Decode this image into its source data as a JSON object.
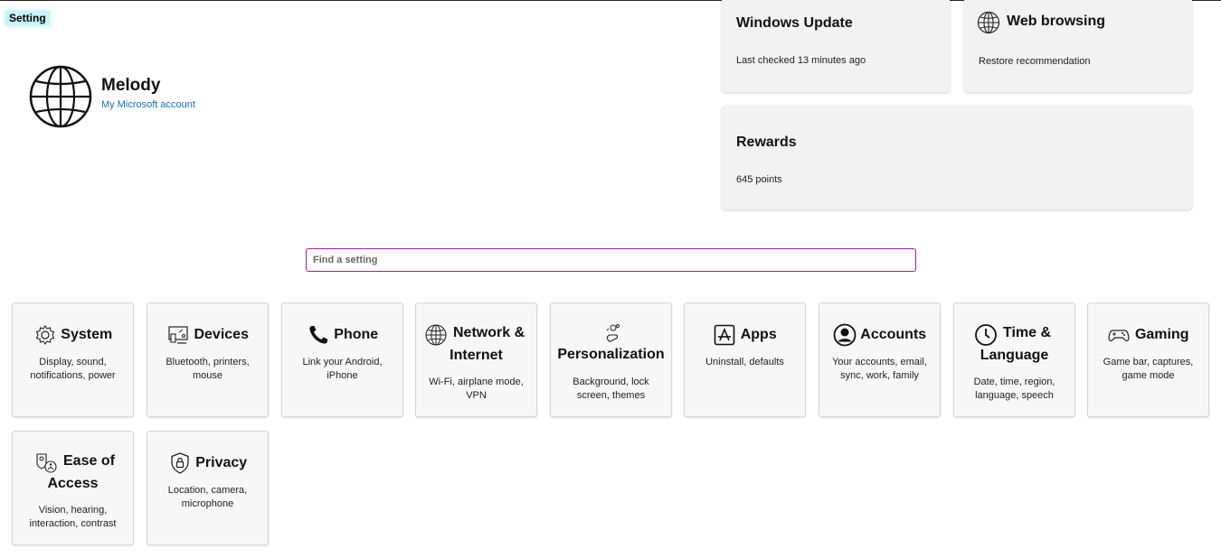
{
  "app": {
    "title": "Setting"
  },
  "profile": {
    "name": "Melody",
    "account_link": "My Microsoft account",
    "avatar_icon": "globe-icon"
  },
  "cards": {
    "windows_update": {
      "title": "Windows Update",
      "subtitle": "Last checked 13 minutes ago"
    },
    "web_browsing": {
      "title": "Web browsing",
      "subtitle": "Restore recommendation",
      "icon": "globe-icon"
    },
    "rewards": {
      "title": "Rewards",
      "subtitle": "645 points"
    }
  },
  "search": {
    "placeholder": "Find a setting",
    "value": "",
    "border_color": "#a11aa7"
  },
  "categories": [
    {
      "label": "System",
      "description": "Display, sound, notifications, power",
      "icon": "gear-icon"
    },
    {
      "label": "Devices",
      "description": "Bluetooth, printers, mouse",
      "icon": "devices-icon"
    },
    {
      "label": "Phone",
      "description": "Link your Android, iPhone",
      "icon": "phone-icon"
    },
    {
      "label_line1": "Network &",
      "label_line2": "Internet",
      "description": "Wi-Fi, airplane mode, VPN",
      "icon": "globe-icon"
    },
    {
      "label": "Personalization",
      "description": "Background, lock screen, themes",
      "icon": "paint-icon"
    },
    {
      "label": "Apps",
      "description": "Uninstall, defaults",
      "icon": "apps-icon"
    },
    {
      "label": "Accounts",
      "description": "Your accounts, email, sync, work, family",
      "icon": "person-icon"
    },
    {
      "label_line1": "Time &",
      "label_line2": "Language",
      "description": "Date, time, region, language, speech",
      "icon": "clock-icon"
    },
    {
      "label": "Gaming",
      "description": "Game bar, captures, game mode",
      "icon": "gamepad-icon"
    },
    {
      "label_line1": "Ease of",
      "label_line2": "Access",
      "description": "Vision, hearing, interaction, contrast",
      "icon": "accessibility-icon"
    },
    {
      "label": "Privacy",
      "description": "Location, camera, microphone",
      "icon": "lock-shield-icon"
    }
  ],
  "colors": {
    "link": "#1a6fb5",
    "title_highlight": "#c9f3f6",
    "card_bg": "#f2f2f2"
  }
}
